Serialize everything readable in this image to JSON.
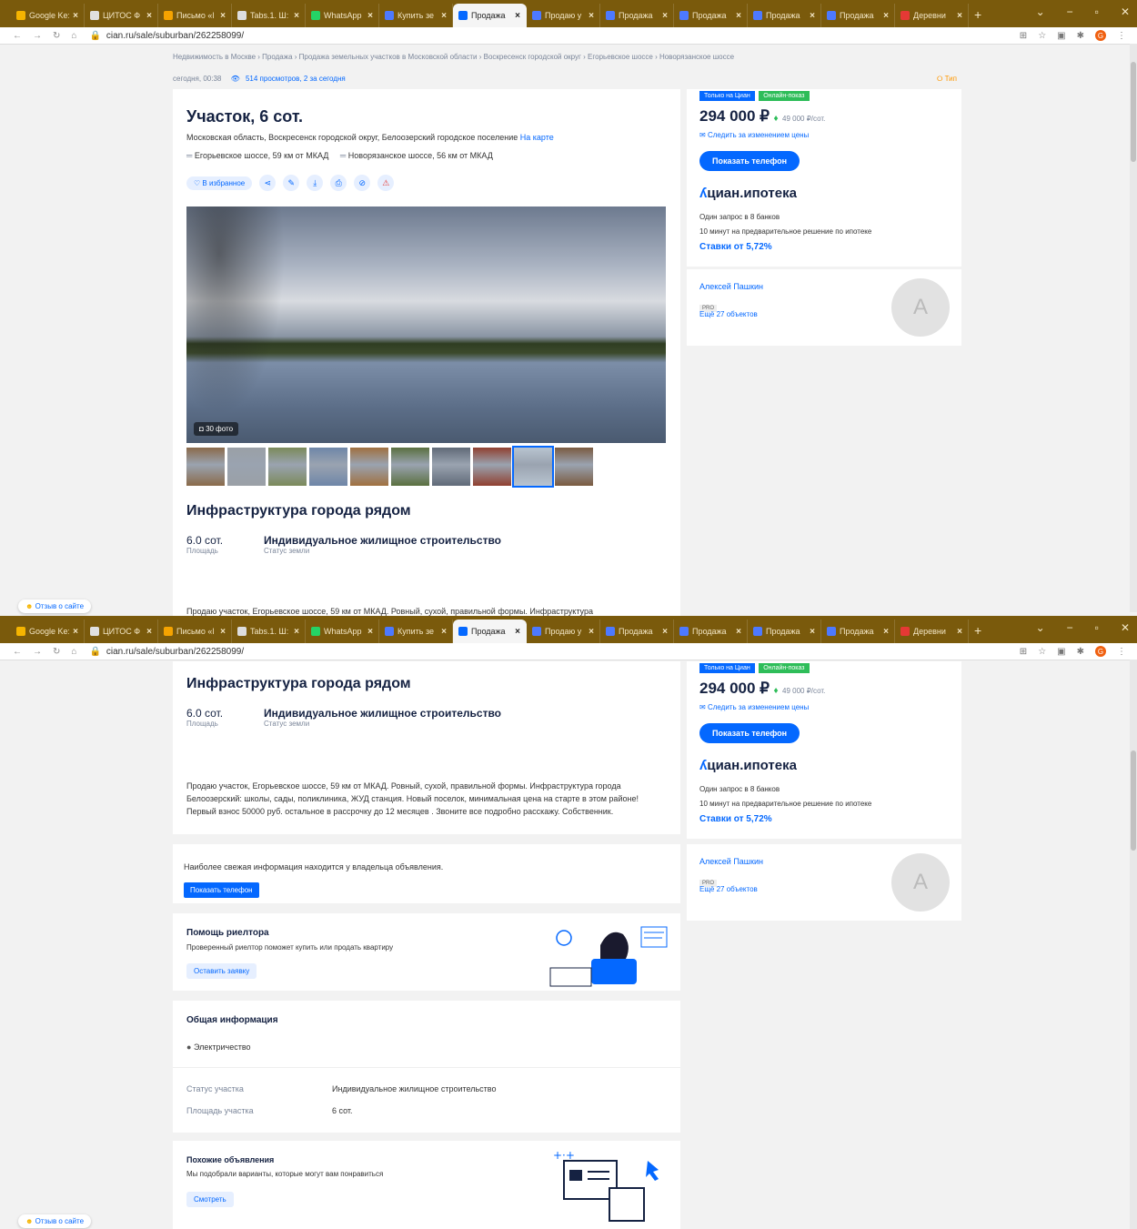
{
  "browser": {
    "tabs": [
      {
        "label": "Google Ke:",
        "color": "#f5b400"
      },
      {
        "label": "ЦИТОС Ф",
        "color": "#e0e0e0"
      },
      {
        "label": "Письмо «l",
        "color": "#f5a300"
      },
      {
        "label": "Tabs.1. Ш:",
        "color": "#dddddd"
      },
      {
        "label": "WhatsApp",
        "color": "#25d366"
      },
      {
        "label": "Купить зе",
        "color": "#4d79ff"
      },
      {
        "label": "Продажа",
        "color": "#0468ff"
      },
      {
        "label": "Продаю у",
        "color": "#4d79ff"
      },
      {
        "label": "Продажа",
        "color": "#4d79ff"
      },
      {
        "label": "Продажа",
        "color": "#4d79ff"
      },
      {
        "label": "Продажа",
        "color": "#4d79ff"
      },
      {
        "label": "Продажа",
        "color": "#4d79ff"
      },
      {
        "label": "Деревни",
        "color": "#e53935"
      }
    ],
    "url": "cian.ru/sale/suburban/262258099/"
  },
  "breadcrumbs": "Недвижимость в Москве  ›  Продажа  ›  Продажа земельных участков в Московской области  ›  Воскресенск городской округ  ›  Егорьевское шоссе  ›  Новорязанское шоссе",
  "meta": {
    "date": "сегодня, 00:38",
    "views": "514 просмотров, 2 за сегодня",
    "tip": "Тип"
  },
  "listing": {
    "title": "Участок, 6 сот.",
    "address": "Московская область, Воскресенск городской округ, Белоозерский городское поселение",
    "map_link": "На карте",
    "highway1": "Егорьевское шоссе, 59 км от МКАД",
    "highway2": "Новорязанское шоссе, 56 км от МКАД",
    "fav_label": "В избранное",
    "photo_count": "30 фото",
    "infra_title": "Инфраструктура города рядом",
    "area_value": "6.0 сот.",
    "area_label": "Площадь",
    "status_value": "Индивидуальное жилищное строительство",
    "status_label": "Статус земли",
    "description": "Продаю участок, Егорьевское шоссе, 59 км от МКАД. Ровный, сухой, правильной формы. Инфраструктура города Белоозерский: школы, сады, поликлиника, ЖУД станция. Новый поселок, минимальная цена на старте в этом районе! Первый взнос 50000 руб. остальное в рассрочку до 12 месяцев . Звоните все подробно расскажу. Собственник.",
    "desc_preview": "Продаю участок, Егорьевское шоссе, 59 км от МКАД. Ровный, сухой, правильной формы. Инфраструктура",
    "owner_info": "Наиболее свежая информация находится у владельца объявления.",
    "show_phone_small": "Показать телефон"
  },
  "realtor": {
    "title": "Помощь риелтора",
    "text": "Проверенный риелтор поможет купить или продать квартиру",
    "button": "Оставить заявку"
  },
  "general": {
    "title": "Общая информация",
    "feature": "Электричество",
    "rows": [
      {
        "label": "Статус участка",
        "value": "Индивидуальное жилищное строительство"
      },
      {
        "label": "Площадь участка",
        "value": "6 сот."
      }
    ]
  },
  "similar": {
    "title": "Похожие объявления",
    "text": "Мы подобрали варианты, которые могут вам понравиться",
    "button": "Смотреть"
  },
  "sidebar": {
    "badge1": "Только на Циан",
    "badge2": "Онлайн-показ",
    "price": "294 000 ₽",
    "price_per": "49 000 ₽/сот.",
    "follow": "Следить за изменением цены",
    "show_phone": "Показать телефон",
    "cian_brand": "циан.ипотека",
    "mortgage1": "Один запрос в 8 банков",
    "mortgage2": "10 минут на предварительное решение по ипотеке",
    "rate": "Ставки от 5,72%",
    "agent_name": "Алексей Пашкин",
    "agent_pro": "PRO",
    "agent_more": "Ещё 27 объектов",
    "avatar_letter": "А"
  },
  "feedback": "Отзыв о сайте",
  "thumb_colors": [
    "#8a6a4a",
    "#9aa0a6",
    "#7b8a5a",
    "#6e86a8",
    "#a07040",
    "#5a7040",
    "#606a78",
    "#904030",
    "#b8c4d0",
    "#7a5a40"
  ]
}
